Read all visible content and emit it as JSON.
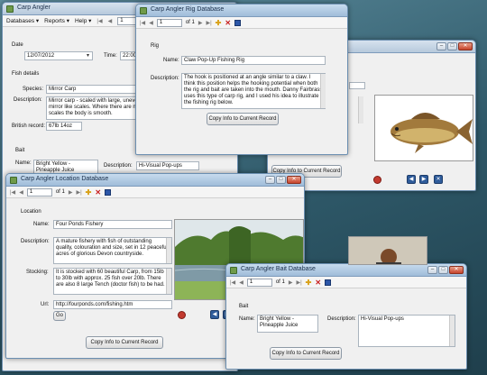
{
  "main_window": {
    "title": "Carp Angler",
    "menu": [
      "Databases ▾",
      "Reports ▾",
      "Help ▾"
    ],
    "record_position": "1",
    "date_label": "Date",
    "date_value": "12/07/2012",
    "time_label": "Time:",
    "time_value": "22:00",
    "fish_section": "Fish details",
    "species_label": "Species:",
    "species_value": "Mirror Carp",
    "description_label": "Description:",
    "description_value": "Mirror carp - scaled with large, uneven mirror like scales. Where there are no scales the body is smooth.",
    "weight_label": "British record:",
    "weight_value": "67lb 14oz",
    "bait_section": "Bait",
    "bait_name_label": "Name:",
    "bait_name_value": "Bright Yellow - Pineapple Juice",
    "bait_desc_label": "Description:",
    "bait_desc_value": "Hi-Visual Pop-ups"
  },
  "rig_window": {
    "title": "Carp Angler Rig Database",
    "record_position": "1",
    "of_label": "of 1",
    "section": "Rig",
    "name_label": "Name:",
    "name_value": "Claw Pop-Up Fishing Rig",
    "desc_label": "Description:",
    "desc_value": "The hook is positioned at an angle similar to a claw. I think this position helps the hooking potential when both the rig and bait are taken into the mouth. Danny Fairbrass uses this type of carp rig, and I used his idea to illustrate the fishing rig below.",
    "copy_button": "Copy Info to Current Record"
  },
  "fish_window": {
    "copy_button": "Copy Info to Current Record"
  },
  "location_window": {
    "title": "Carp Angler Location Database",
    "record_position": "1",
    "of_label": "of 1",
    "section": "Location",
    "name_label": "Name:",
    "name_value": "Four Ponds Fishery",
    "desc_label": "Description:",
    "desc_value": "A mature fishery with fish of outstanding quality, colouration and size, set in 12 peaceful acres of glorious Devon countryside.",
    "stocking_label": "Stocking:",
    "stocking_value": "It is stocked with 60 beautiful Carp, from 15lb to 30lb with approx. 25 fish over 20lb. There are also 8 large Tench (doctor fish) to be had.",
    "url_label": "Url:",
    "url_value": "http://fourponds.com/fishing.htm",
    "go_button": "Go",
    "copy_button": "Copy Info to Current Record"
  },
  "bait_window": {
    "title": "Carp Angler Bait Database",
    "record_position": "1",
    "of_label": "of 1",
    "section": "Bait",
    "name_label": "Name:",
    "name_value": "Bright Yellow - Pineapple Juice",
    "desc_label": "Description:",
    "desc_value": "Hi-Visual Pop-ups",
    "copy_button": "Copy Info to Current Record"
  }
}
